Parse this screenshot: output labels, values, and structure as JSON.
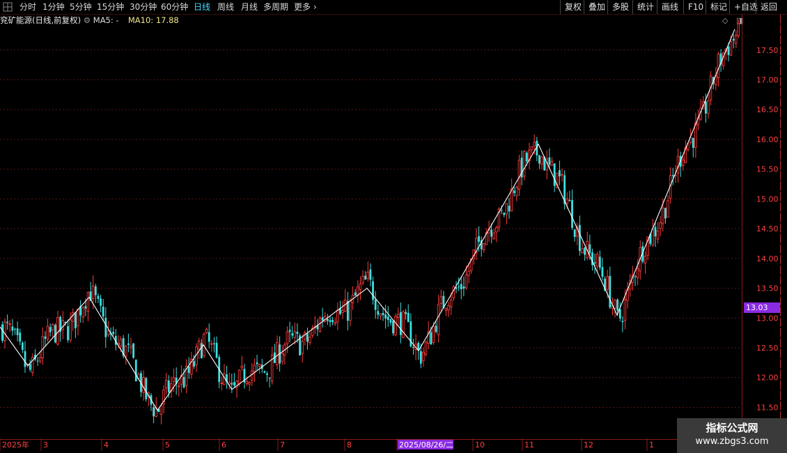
{
  "toolbar": {
    "period_tabs": [
      "分时",
      "1分钟",
      "5分钟",
      "15分钟",
      "30分钟",
      "60分钟",
      "日线",
      "周线",
      "月线",
      "多周期",
      "更多"
    ],
    "active_tab": "日线",
    "right_buttons": [
      "复权",
      "叠加",
      "多股",
      "统计",
      "画线",
      "F10",
      "标记",
      "+自选",
      "返回"
    ]
  },
  "info_line": {
    "stock_name": "兖矿能源(日线,前复权)",
    "ma5_label": "MA5: -",
    "ma10_label": "MA10: 17.88"
  },
  "current_price_tag": "13.03",
  "watermark": {
    "title": "指标公式网",
    "url": "www.zbgs3.com"
  },
  "colors": {
    "up": "#ff3b3b",
    "down": "#3fe0e0",
    "grid": "#5a1515",
    "zigzag": "#ffffff",
    "axis_text": "#ff4040",
    "highlight": "#8a2be2"
  },
  "chart_data": {
    "type": "candlestick",
    "title": "兖矿能源(日线,前复权)",
    "y_ticks": [
      11.5,
      12.0,
      12.5,
      13.0,
      13.5,
      14.0,
      14.5,
      15.0,
      15.5,
      16.0,
      16.5,
      17.0,
      17.5
    ],
    "ylim": [
      11.2,
      17.9
    ],
    "x_labels": [
      "2025年",
      "3",
      "4",
      "5",
      "6",
      "7",
      "8",
      "2025/08/26/二",
      "10",
      "11",
      "12",
      "1"
    ],
    "highlighted_x_label": "2025/08/26/二",
    "zigzag_points": [
      {
        "date": "2025-01-06",
        "price": 12.85
      },
      {
        "date": "2025-01-14",
        "price": 12.2
      },
      {
        "date": "2025-02-20",
        "price": 13.35
      },
      {
        "date": "2025-04-08",
        "price": 11.45
      },
      {
        "date": "2025-05-13",
        "price": 12.55
      },
      {
        "date": "2025-06-05",
        "price": 11.8
      },
      {
        "date": "2025-07-30",
        "price": 13.5
      },
      {
        "date": "2025-08-29",
        "price": 12.45
      },
      {
        "date": "2025-11-06",
        "price": 15.92
      },
      {
        "date": "2025-12-25",
        "price": 13.05
      },
      {
        "date": "2026-02-26",
        "price": 17.85
      }
    ],
    "grid": true,
    "candles_shown": "approx. 290 daily candles; red = rising, cyan = falling"
  }
}
